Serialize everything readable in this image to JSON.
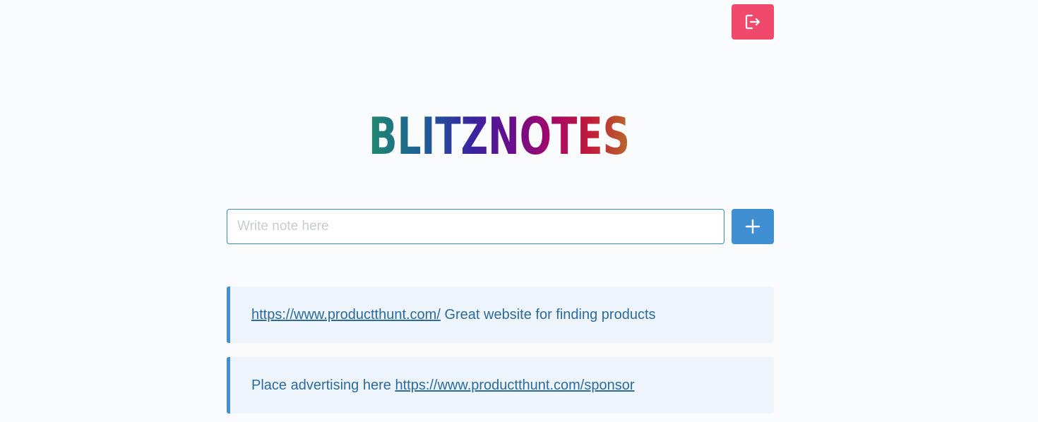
{
  "app": {
    "logo_text": "BLITZNOTES"
  },
  "colors": {
    "logout_bg": "#ef4a6b",
    "add_bg": "#3f8fd2",
    "card_bg": "#eef4fb",
    "card_accent": "#3f8fd2",
    "text": "#2b6a9e"
  },
  "header": {
    "logout_icon": "logout-icon"
  },
  "composer": {
    "placeholder": "Write note here",
    "value": "",
    "add_icon": "plus-icon"
  },
  "notes": [
    {
      "link": "https://www.productthunt.com/",
      "text_after": " Great website for finding products"
    },
    {
      "text_before": "Place advertising here ",
      "link": "https://www.productthunt.com/sponsor"
    }
  ]
}
